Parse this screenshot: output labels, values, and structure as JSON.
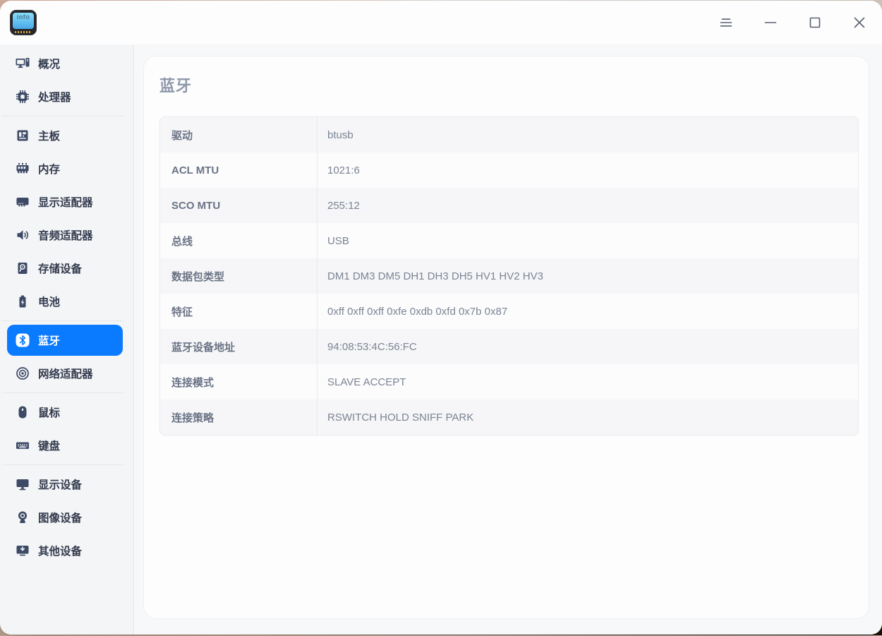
{
  "titlebar": {
    "app_icon_text": "info",
    "controls": [
      {
        "name": "menu",
        "icon": "menu-icon"
      },
      {
        "name": "minimize",
        "icon": "minimize-icon"
      },
      {
        "name": "maximize",
        "icon": "maximize-icon"
      },
      {
        "name": "close",
        "icon": "close-icon"
      }
    ]
  },
  "sidebar": {
    "items": [
      {
        "label": "概况",
        "icon": "overview-icon",
        "selected": false
      },
      {
        "label": "处理器",
        "icon": "cpu-icon",
        "selected": false
      },
      {
        "label": "主板",
        "icon": "motherboard-icon",
        "selected": false
      },
      {
        "label": "内存",
        "icon": "memory-icon",
        "selected": false
      },
      {
        "label": "显示适配器",
        "icon": "display-adapter-icon",
        "selected": false
      },
      {
        "label": "音频适配器",
        "icon": "audio-adapter-icon",
        "selected": false
      },
      {
        "label": "存储设备",
        "icon": "storage-icon",
        "selected": false
      },
      {
        "label": "电池",
        "icon": "battery-icon",
        "selected": false
      },
      {
        "label": "蓝牙",
        "icon": "bluetooth-icon",
        "selected": true
      },
      {
        "label": "网络适配器",
        "icon": "network-adapter-icon",
        "selected": false
      },
      {
        "label": "鼠标",
        "icon": "mouse-icon",
        "selected": false
      },
      {
        "label": "键盘",
        "icon": "keyboard-icon",
        "selected": false
      },
      {
        "label": "显示设备",
        "icon": "display-device-icon",
        "selected": false
      },
      {
        "label": "图像设备",
        "icon": "camera-icon",
        "selected": false
      },
      {
        "label": "其他设备",
        "icon": "other-devices-icon",
        "selected": false
      }
    ],
    "dividers_after": [
      "处理器",
      "电池",
      "网络适配器",
      "键盘"
    ]
  },
  "main": {
    "title": "蓝牙",
    "table": {
      "rows": [
        {
          "key": "驱动",
          "value": "btusb"
        },
        {
          "key": "ACL MTU",
          "value": "1021:6"
        },
        {
          "key": "SCO MTU",
          "value": "255:12"
        },
        {
          "key": "总线",
          "value": "USB"
        },
        {
          "key": "数据包类型",
          "value": "DM1 DM3 DM5 DH1 DH3 DH5 HV1 HV2 HV3"
        },
        {
          "key": "特征",
          "value": "0xff 0xff 0xff 0xfe 0xdb 0xfd 0x7b 0x87"
        },
        {
          "key": "蓝牙设备地址",
          "value": "94:08:53:4C:56:FC"
        },
        {
          "key": "连接模式",
          "value": "SLAVE ACCEPT"
        },
        {
          "key": "连接策略",
          "value": "RSWITCH HOLD SNIFF PARK"
        }
      ]
    }
  },
  "colors": {
    "accent": "#0a7aff",
    "sidebar_bg": "#f4f5f7",
    "icon_navy": "#3d4a66",
    "row_alt": "#f6f6f8",
    "title_text": "#8f98aa",
    "key_text": "#6a7385",
    "value_text": "#7b8494"
  }
}
